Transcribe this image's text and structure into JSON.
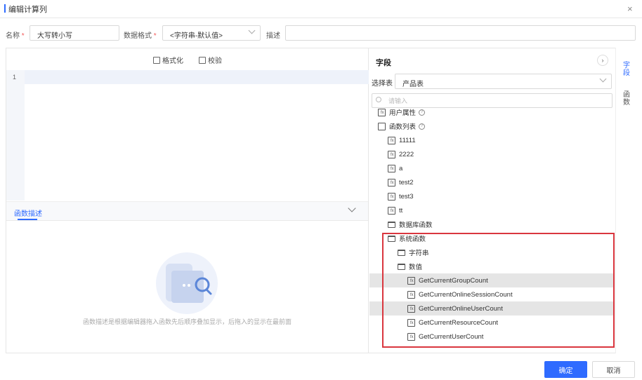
{
  "dialog": {
    "title": "编辑计算列",
    "close": "×"
  },
  "form": {
    "name_label": "名称",
    "name_required": "*",
    "name_value": "大写转小写",
    "format_label": "数据格式",
    "format_required": "*",
    "format_value": "<字符串-默认值>",
    "desc_label": "描述",
    "desc_value": ""
  },
  "editor": {
    "format_btn": "格式化",
    "validate_btn": "校验",
    "line_numbers": [
      "1"
    ],
    "desc_tab": "函数描述",
    "empty_text": "函数描述是根据编辑器拖入函数先后顺序叠加显示，后拖入的显示在最前面"
  },
  "fields": {
    "title": "字段",
    "expand_btn": "›",
    "table_label": "选择表",
    "table_value": "产品表",
    "search_placeholder": "请输入",
    "tree": [
      {
        "label": "用户属性",
        "icon": "user-attr-icon",
        "level": 0,
        "help": true
      },
      {
        "label": "函数列表",
        "icon": "function-list-icon",
        "level": 0,
        "help": true
      },
      {
        "label": "11111",
        "icon": "function-icon",
        "level": 1
      },
      {
        "label": "2222",
        "icon": "function-icon",
        "level": 1
      },
      {
        "label": "a",
        "icon": "function-icon",
        "level": 1
      },
      {
        "label": "test2",
        "icon": "function-icon",
        "level": 1
      },
      {
        "label": "test3",
        "icon": "function-icon",
        "level": 1
      },
      {
        "label": "tt",
        "icon": "function-icon",
        "level": 1
      },
      {
        "label": "数据库函数",
        "icon": "folder-icon",
        "level": 1
      },
      {
        "label": "系统函数",
        "icon": "folder-icon",
        "level": 1
      },
      {
        "label": "字符串",
        "icon": "folder-icon",
        "level": 2
      },
      {
        "label": "数值",
        "icon": "folder-icon",
        "level": 2
      },
      {
        "label": "GetCurrentGroupCount",
        "icon": "function-icon",
        "level": 3,
        "highlight": true
      },
      {
        "label": "GetCurrentOnlineSessionCount",
        "icon": "function-icon",
        "level": 3
      },
      {
        "label": "GetCurrentOnlineUserCount",
        "icon": "function-icon",
        "level": 3,
        "highlight": true
      },
      {
        "label": "GetCurrentResourceCount",
        "icon": "function-icon",
        "level": 3
      },
      {
        "label": "GetCurrentUserCount",
        "icon": "function-icon",
        "level": 3
      }
    ]
  },
  "rail": {
    "tab_fields": "字段",
    "tab_functions": "函数"
  },
  "footer": {
    "confirm": "确定",
    "cancel": "取消"
  },
  "colors": {
    "primary": "#2f6bff",
    "highlight_box": "#d9363e",
    "row_highlight": "#e5e5e5"
  }
}
